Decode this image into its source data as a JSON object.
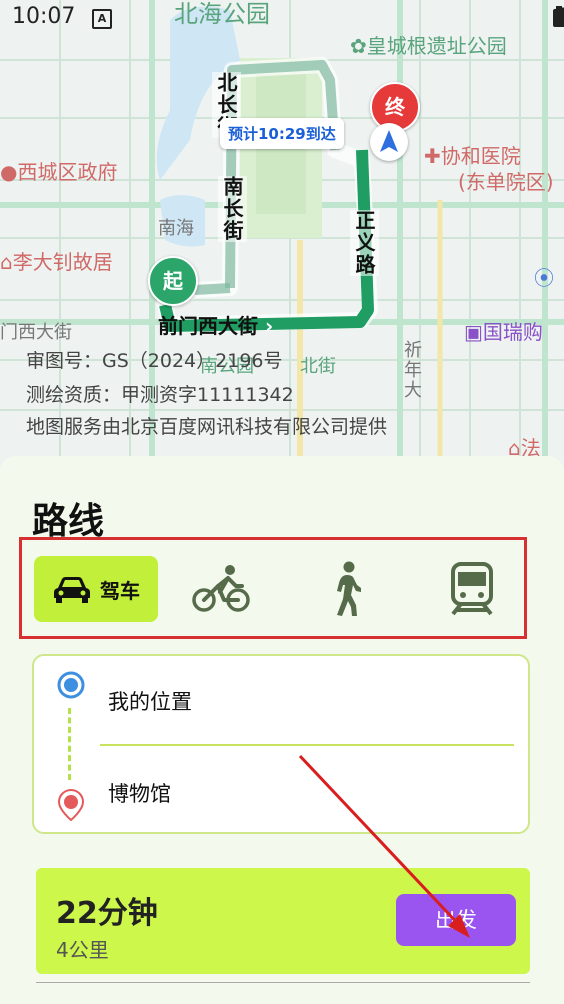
{
  "status": {
    "time": "10:07",
    "notification_icon": "a-icon",
    "icons": [
      "location-icon",
      "wifi-icon",
      "signal-icon",
      "battery-icon"
    ]
  },
  "map": {
    "poi_labels": {
      "beihai_park": "北海公园",
      "imperial_wall": "皇城根遗址公园",
      "xicheng_gov": "西城区政府",
      "peking_union": "协和医院",
      "peking_union_sub": "(东单院区)",
      "nanhai": "南海",
      "li_dazhao": "李大钊故居",
      "guorui": "国瑞购",
      "fa": "法",
      "qianmen_west": "门西大街",
      "park_bottom": "南公园",
      "park_bottom2": "北街"
    },
    "roads": {
      "beichang": "北长街",
      "nanchang": "南长街",
      "zhengyi": "正义路",
      "qianmen": "前门西大街",
      "xinnian": "祈年大"
    },
    "eta": "预计10:29到达",
    "start_marker": "起",
    "end_marker": "终",
    "copyright": [
      "审图号：GS（2024）2196号",
      "测绘资质：甲测资字11111342",
      "地图服务由北京百度网讯科技有限公司提供"
    ]
  },
  "panel": {
    "title": "路线",
    "modes": [
      {
        "name": "drive",
        "label": "驾车",
        "icon": "car-icon",
        "active": true
      },
      {
        "name": "bike",
        "label": "",
        "icon": "bicycle-icon",
        "active": false
      },
      {
        "name": "walk",
        "label": "",
        "icon": "walking-icon",
        "active": false
      },
      {
        "name": "transit",
        "label": "",
        "icon": "train-icon",
        "active": false
      }
    ],
    "origin": "我的位置",
    "destination": "博物馆",
    "result": {
      "duration": "22分钟",
      "distance": "4公里",
      "go_label": "出发"
    }
  },
  "colors": {
    "accent_green": "#c2f03a",
    "button_purple": "#9a55f0",
    "highlight_red": "#d83030",
    "route_green": "#1f9d63"
  }
}
